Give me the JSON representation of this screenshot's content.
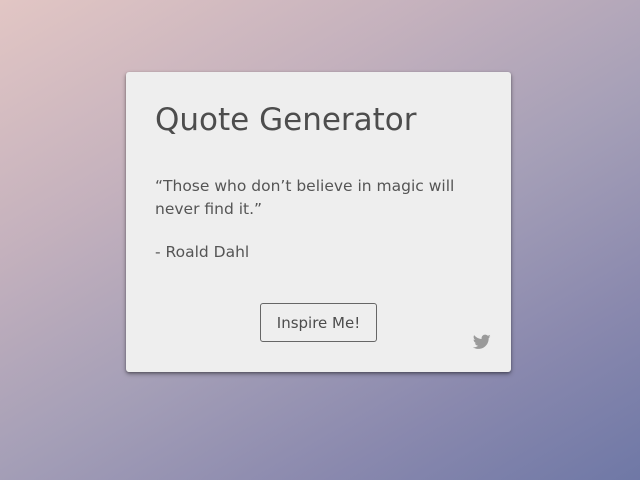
{
  "card": {
    "title": "Quote Generator",
    "quote": "“Those who don’t believe in magic will never find it.”",
    "author": "- Roald Dahl",
    "button_label": "Inspire Me!",
    "tweet_icon": "twitter-bird-icon"
  },
  "colors": {
    "card_background": "#eeeeee",
    "text": "#4d4d4d",
    "icon": "#9a9a9a",
    "gradient_start": "#e2c6c4",
    "gradient_end": "#6f78a6"
  }
}
